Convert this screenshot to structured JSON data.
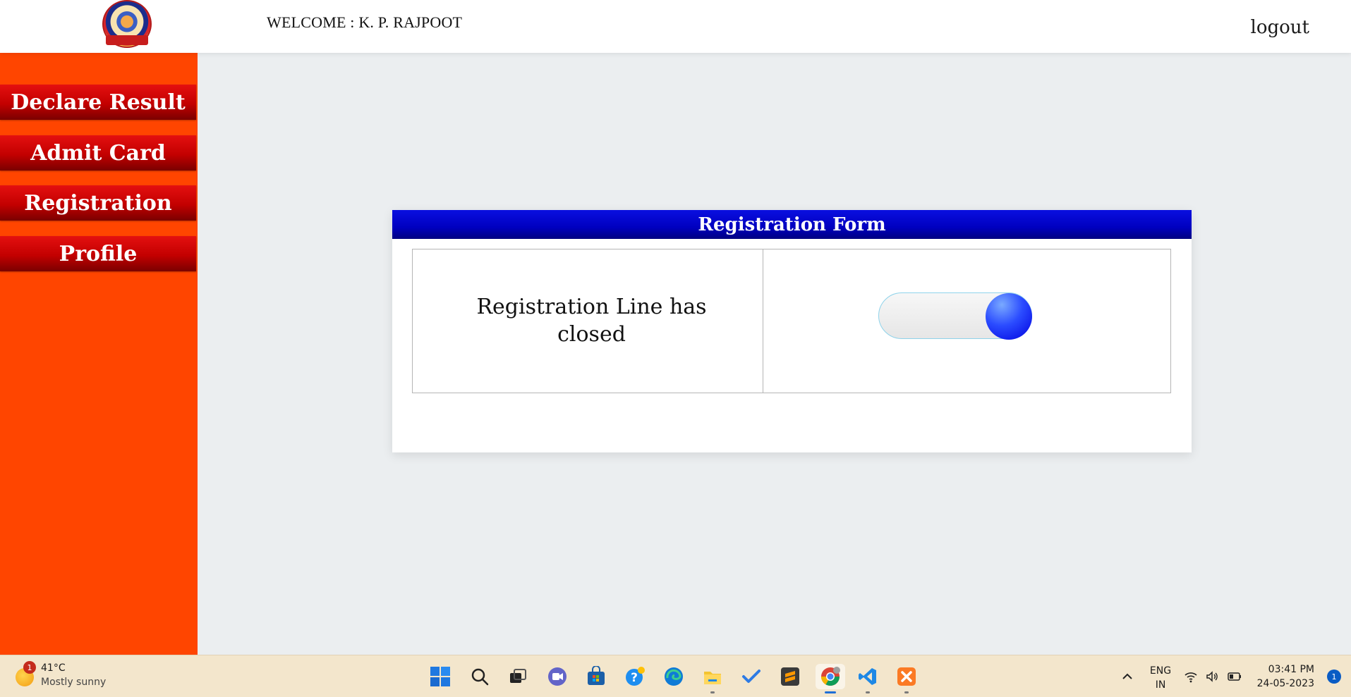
{
  "header": {
    "welcome_text": "WELCOME : K. P. RAJPOOT",
    "logout_label": "logout"
  },
  "sidebar": {
    "items": [
      {
        "label": "Declare Result"
      },
      {
        "label": "Admit Card"
      },
      {
        "label": "Registration"
      },
      {
        "label": "Profile"
      }
    ]
  },
  "main": {
    "card_title": "Registration Form",
    "status_line1": "Registration Line has",
    "status_line2": "closed",
    "toggle_state": "on"
  },
  "colors": {
    "sidebar_bg": "#ff4500",
    "nav_button": "#c30000",
    "card_header": "#0000c0",
    "toggle_knob": "#0000e0"
  },
  "taskbar": {
    "weather": {
      "temp": "41°C",
      "desc": "Mostly sunny",
      "badge": "1"
    },
    "apps": [
      {
        "icon": "windows-start-icon"
      },
      {
        "icon": "search-icon"
      },
      {
        "icon": "task-view-icon"
      },
      {
        "icon": "teams-chat-icon"
      },
      {
        "icon": "microsoft-store-icon"
      },
      {
        "icon": "get-help-icon"
      },
      {
        "icon": "edge-browser-icon"
      },
      {
        "icon": "file-explorer-icon"
      },
      {
        "icon": "todo-icon"
      },
      {
        "icon": "sublime-text-icon"
      },
      {
        "icon": "chrome-icon"
      },
      {
        "icon": "vscode-icon"
      },
      {
        "icon": "xampp-icon"
      }
    ],
    "tray": {
      "lang_line1": "ENG",
      "lang_line2": "IN",
      "time": "03:41 PM",
      "date": "24-05-2023",
      "notification_count": "1"
    }
  }
}
